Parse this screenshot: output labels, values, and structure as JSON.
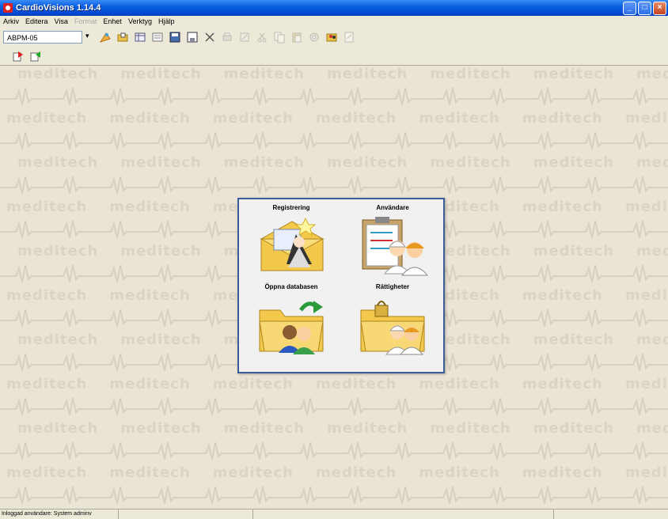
{
  "window": {
    "title": "CardioVisions 1.14.4",
    "buttons": {
      "minimize": "_",
      "maximize": "□",
      "close": "×"
    }
  },
  "menu": {
    "items": [
      {
        "label": "Arkiv",
        "disabled": false
      },
      {
        "label": "Editera",
        "disabled": false
      },
      {
        "label": "Visa",
        "disabled": false
      },
      {
        "label": "Format",
        "disabled": true
      },
      {
        "label": "Enhet",
        "disabled": false
      },
      {
        "label": "Verktyg",
        "disabled": false
      },
      {
        "label": "Hjälp",
        "disabled": false
      }
    ]
  },
  "toolbar": {
    "device_select_value": "ABPM-05",
    "buttons": [
      {
        "icon": "wizard-icon",
        "disabled": false
      },
      {
        "icon": "open-icon",
        "disabled": false
      },
      {
        "icon": "table-icon",
        "disabled": false
      },
      {
        "icon": "form-icon",
        "disabled": false
      },
      {
        "icon": "save-as-icon",
        "disabled": false
      },
      {
        "icon": "save-icon",
        "disabled": false
      },
      {
        "icon": "delete-icon",
        "disabled": false
      },
      {
        "icon": "print-icon",
        "disabled": true
      },
      {
        "icon": "edit-icon",
        "disabled": true
      },
      {
        "icon": "cut-icon",
        "disabled": true
      },
      {
        "icon": "copy-icon",
        "disabled": true
      },
      {
        "icon": "paste-icon",
        "disabled": true
      },
      {
        "icon": "settings-icon",
        "disabled": true
      },
      {
        "icon": "users-icon",
        "disabled": false
      },
      {
        "icon": "report-icon",
        "disabled": true
      }
    ],
    "secondary_buttons": [
      {
        "icon": "logout-icon"
      },
      {
        "icon": "login-icon"
      }
    ]
  },
  "background": {
    "watermark": "meditech"
  },
  "panel": {
    "tiles": [
      {
        "label": "Registrering",
        "icon": "registration-wizard-icon"
      },
      {
        "label": "Användare",
        "icon": "users-clipboard-icon"
      },
      {
        "label": "Öppna databasen",
        "icon": "open-database-folder-icon"
      },
      {
        "label": "Rättigheter",
        "icon": "permissions-folder-icon"
      }
    ]
  },
  "statusbar": {
    "message": "Inloggad användare: System adminv"
  },
  "colors": {
    "titlebar": "#0a5fe0",
    "panel_border": "#3b5b9a",
    "workspace": "#eae4d6"
  }
}
